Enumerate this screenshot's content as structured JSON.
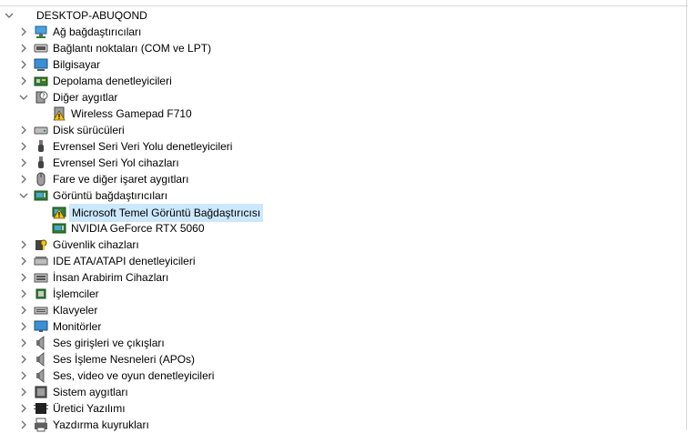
{
  "tree": {
    "root": {
      "label": "DESKTOP-ABUQOND",
      "expanded": true
    },
    "categories": [
      {
        "label": "Ağ bağdaştırıcıları",
        "icon": "network-adapter-icon",
        "expanded": false
      },
      {
        "label": "Bağlantı noktaları (COM ve LPT)",
        "icon": "port-icon",
        "expanded": false
      },
      {
        "label": "Bilgisayar",
        "icon": "computer-icon",
        "expanded": false
      },
      {
        "label": "Depolama denetleyicileri",
        "icon": "storage-controller-icon",
        "expanded": false
      },
      {
        "label": "Diğer aygıtlar",
        "icon": "unknown-device-icon",
        "expanded": true,
        "children": [
          {
            "label": "Wireless Gamepad F710",
            "icon": "warning-device-icon"
          }
        ]
      },
      {
        "label": "Disk sürücüleri",
        "icon": "disk-drive-icon",
        "expanded": false
      },
      {
        "label": "Evrensel Seri Veri Yolu denetleyicileri",
        "icon": "usb-icon",
        "expanded": false
      },
      {
        "label": "Evrensel Seri Yol cihazları",
        "icon": "usb-icon",
        "expanded": false
      },
      {
        "label": "Fare ve diğer işaret aygıtları",
        "icon": "mouse-icon",
        "expanded": false
      },
      {
        "label": "Görüntü bağdaştırıcıları",
        "icon": "display-adapter-icon",
        "expanded": true,
        "children": [
          {
            "label": "Microsoft Temel Görüntü Bağdaştırıcısı",
            "icon": "warning-display-adapter-icon",
            "selected": true
          },
          {
            "label": "NVIDIA GeForce RTX 5060",
            "icon": "display-adapter-icon"
          }
        ]
      },
      {
        "label": "Güvenlik cihazları",
        "icon": "security-device-icon",
        "expanded": false
      },
      {
        "label": "IDE ATA/ATAPI denetleyicileri",
        "icon": "ide-controller-icon",
        "expanded": false
      },
      {
        "label": "İnsan Arabirim Cihazları",
        "icon": "hid-icon",
        "expanded": false
      },
      {
        "label": "İşlemciler",
        "icon": "processor-icon",
        "expanded": false
      },
      {
        "label": "Klavyeler",
        "icon": "keyboard-icon",
        "expanded": false
      },
      {
        "label": "Monitörler",
        "icon": "monitor-icon",
        "expanded": false
      },
      {
        "label": "Ses girişleri ve çıkışları",
        "icon": "speaker-icon",
        "expanded": false
      },
      {
        "label": "Ses İşleme Nesneleri (APOs)",
        "icon": "speaker-icon",
        "expanded": false
      },
      {
        "label": "Ses, video ve oyun denetleyicileri",
        "icon": "speaker-icon",
        "expanded": false
      },
      {
        "label": "Sistem aygıtları",
        "icon": "system-device-icon",
        "expanded": false
      },
      {
        "label": "Üretici Yazılımı",
        "icon": "firmware-icon",
        "expanded": false
      },
      {
        "label": "Yazdırma kuyrukları",
        "icon": "printer-icon",
        "expanded": false
      }
    ]
  },
  "colors": {
    "selection": "#cce8ff",
    "chevron": "#6b6b6b"
  }
}
